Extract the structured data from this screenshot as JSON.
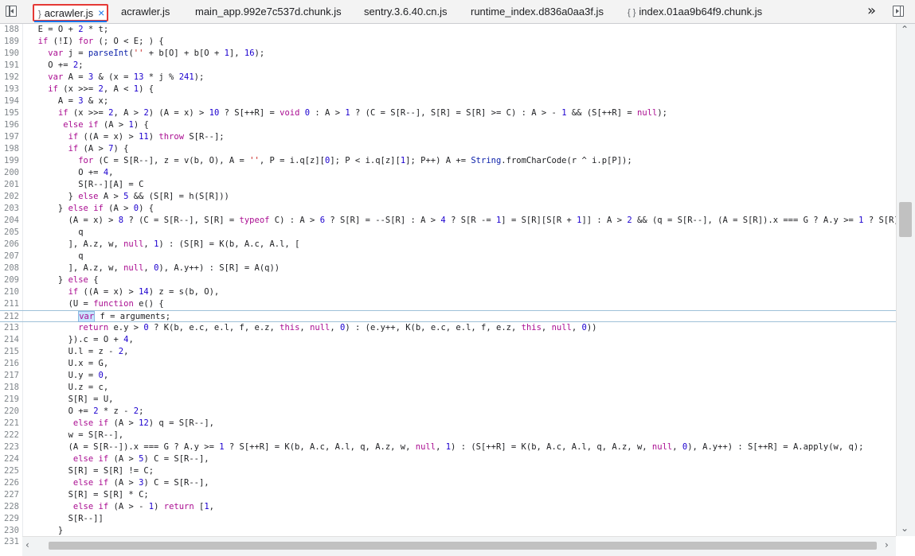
{
  "tabs": [
    {
      "label": "acrawler.js",
      "icon": "}",
      "active": true
    },
    {
      "label": "acrawler.js",
      "icon": "",
      "active": false
    },
    {
      "label": "main_app.992e7c537d.chunk.js",
      "icon": "",
      "active": false
    },
    {
      "label": "sentry.3.6.40.cn.js",
      "icon": "",
      "active": false
    },
    {
      "label": "runtime_index.d836a0aa3f.js",
      "icon": "",
      "active": false
    },
    {
      "label": "index.01aa9b64f9.chunk.js",
      "icon": "{ }",
      "active": false
    }
  ],
  "tab_close_glyph": "×",
  "more_tabs_glyph": "»",
  "lines": [
    {
      "n": "188",
      "code": "  E = O + 2 * t;"
    },
    {
      "n": "189",
      "code": "  if (!I) for (; O < E; ) {"
    },
    {
      "n": "190",
      "code": "    var j = parseInt('' + b[O] + b[O + 1], 16);"
    },
    {
      "n": "191",
      "code": "    O += 2;"
    },
    {
      "n": "192",
      "code": "    var A = 3 & (x = 13 * j % 241);"
    },
    {
      "n": "193",
      "code": "    if (x >>= 2, A < 1) {"
    },
    {
      "n": "194",
      "code": "      A = 3 & x;"
    },
    {
      "n": "195",
      "code": "      if (x >>= 2, A > 2) (A = x) > 10 ? S[++R] = void 0 : A > 1 ? (C = S[R--], S[R] = S[R] >= C) : A > - 1 && (S[++R] = null);"
    },
    {
      "n": "196",
      "code": "       else if (A > 1) {"
    },
    {
      "n": "197",
      "code": "        if ((A = x) > 11) throw S[R--];"
    },
    {
      "n": "198",
      "code": "        if (A > 7) {"
    },
    {
      "n": "199",
      "code": "          for (C = S[R--], z = v(b, O), A = '', P = i.q[z][0]; P < i.q[z][1]; P++) A += String.fromCharCode(r ^ i.p[P]);"
    },
    {
      "n": "200",
      "code": "          O += 4,"
    },
    {
      "n": "201",
      "code": "          S[R--][A] = C"
    },
    {
      "n": "202",
      "code": "        } else A > 5 && (S[R] = h(S[R]))"
    },
    {
      "n": "203",
      "code": "      } else if (A > 0) {"
    },
    {
      "n": "204",
      "code": "        (A = x) > 8 ? (C = S[R--], S[R] = typeof C) : A > 6 ? S[R] = --S[R] : A > 4 ? S[R -= 1] = S[R][S[R + 1]] : A > 2 && (q = S[R--], (A = S[R]).x === G ? A.y >= 1 ? S[R] = K(b,"
    },
    {
      "n": "205",
      "code": "          q"
    },
    {
      "n": "206",
      "code": "        ], A.z, w, null, 1) : (S[R] = K(b, A.c, A.l, ["
    },
    {
      "n": "207",
      "code": "          q"
    },
    {
      "n": "208",
      "code": "        ], A.z, w, null, 0), A.y++) : S[R] = A(q))"
    },
    {
      "n": "209",
      "code": "      } else {"
    },
    {
      "n": "210",
      "code": "        if ((A = x) > 14) z = s(b, O),"
    },
    {
      "n": "211",
      "code": "        (U = function e() {"
    },
    {
      "n": "212",
      "code": "          var f = arguments;"
    },
    {
      "n": "213",
      "code": "          return e.y > 0 ? K(b, e.c, e.l, f, e.z, this, null, 0) : (e.y++, K(b, e.c, e.l, f, e.z, this, null, 0))"
    },
    {
      "n": "214",
      "code": "        }).c = O + 4,"
    },
    {
      "n": "215",
      "code": "        U.l = z - 2,"
    },
    {
      "n": "216",
      "code": "        U.x = G,"
    },
    {
      "n": "217",
      "code": "        U.y = 0,"
    },
    {
      "n": "218",
      "code": "        U.z = c,"
    },
    {
      "n": "219",
      "code": "        S[R] = U,"
    },
    {
      "n": "220",
      "code": "        O += 2 * z - 2;"
    },
    {
      "n": "221",
      "code": "         else if (A > 12) q = S[R--],"
    },
    {
      "n": "222",
      "code": "        w = S[R--],"
    },
    {
      "n": "223",
      "code": "        (A = S[R--]).x === G ? A.y >= 1 ? S[++R] = K(b, A.c, A.l, q, A.z, w, null, 1) : (S[++R] = K(b, A.c, A.l, q, A.z, w, null, 0), A.y++) : S[++R] = A.apply(w, q);"
    },
    {
      "n": "224",
      "code": "         else if (A > 5) C = S[R--],"
    },
    {
      "n": "225",
      "code": "        S[R] = S[R] != C;"
    },
    {
      "n": "226",
      "code": "         else if (A > 3) C = S[R--],"
    },
    {
      "n": "227",
      "code": "        S[R] = S[R] * C;"
    },
    {
      "n": "228",
      "code": "         else if (A > - 1) return [1,"
    },
    {
      "n": "229",
      "code": "        S[R--]]"
    },
    {
      "n": "230",
      "code": "      }"
    }
  ],
  "bottom_line_number": "231",
  "cursor_line": "212",
  "colors": {
    "accent": "#1a73e8",
    "highlight_box": "#e53935",
    "keyword": "#aa0d91",
    "number": "#1c00cf",
    "string": "#c41a16",
    "builtin": "#0d22aa"
  }
}
